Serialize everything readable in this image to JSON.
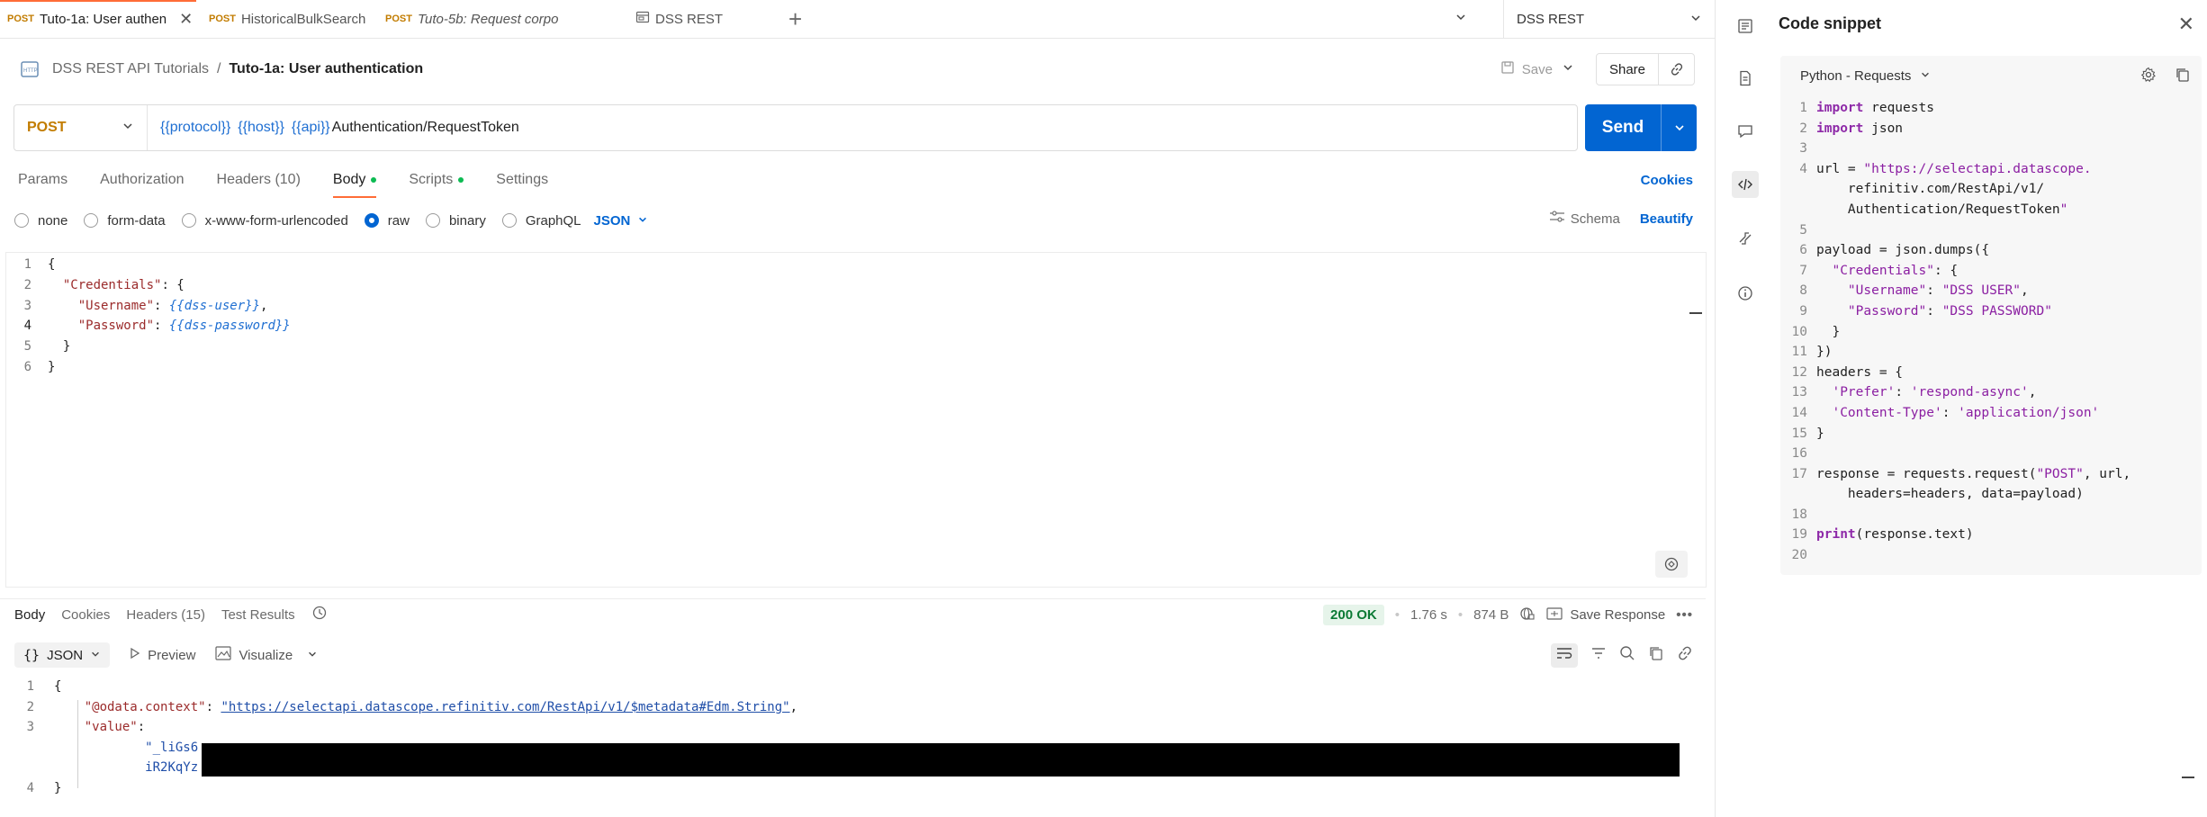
{
  "tabs": [
    {
      "method": "POST",
      "title": "Tuto-1a: User authen",
      "active": true
    },
    {
      "method": "POST",
      "title": "HistoricalBulkSearch",
      "active": false
    },
    {
      "method": "POST",
      "title": "Tuto-5b: Request corpo",
      "active": false
    },
    {
      "method": "",
      "title": "DSS REST",
      "active": false
    }
  ],
  "environment": "DSS REST",
  "breadcrumb": {
    "collection": "DSS REST API Tutorials",
    "request": "Tuto-1a: User authentication"
  },
  "toolbar": {
    "save_label": "Save",
    "share_label": "Share"
  },
  "request": {
    "method": "POST",
    "url_vars": [
      "{{protocol}}",
      "{{host}}",
      "{{api}}"
    ],
    "url_path": "Authentication/RequestToken",
    "send_label": "Send"
  },
  "request_tabs": {
    "params": "Params",
    "authorization": "Authorization",
    "headers": "Headers",
    "headers_count": "(10)",
    "body": "Body",
    "scripts": "Scripts",
    "settings": "Settings",
    "cookies": "Cookies"
  },
  "body_options": {
    "none": "none",
    "form_data": "form-data",
    "urlencoded": "x-www-form-urlencoded",
    "raw": "raw",
    "binary": "binary",
    "graphql": "GraphQL",
    "format": "JSON",
    "schema": "Schema",
    "beautify": "Beautify",
    "selected": "raw"
  },
  "body_code": {
    "l1": "{",
    "l2_key": "\"Credentials\"",
    "l2_rest": ": {",
    "l3_key": "\"Username\"",
    "l3_val": "{{dss-user}}",
    "l4_key": "\"Password\"",
    "l4_val": "{{dss-password}}",
    "l5": "}",
    "l6": "}"
  },
  "response_tabs": {
    "body": "Body",
    "cookies": "Cookies",
    "headers": "Headers (15)",
    "test_results": "Test Results"
  },
  "response_meta": {
    "status": "200 OK",
    "time": "1.76 s",
    "size": "874 B",
    "save_response": "Save Response"
  },
  "response_options": {
    "format": "JSON",
    "preview": "Preview",
    "visualize": "Visualize"
  },
  "response_code": {
    "l1": "{",
    "context_key": "\"@odata.context\"",
    "context_val": "\"https://selectapi.datascope.refinitiv.com/RestApi/v1/$metadata#Edm.String\"",
    "value_key": "\"value\"",
    "value_start": "\"_liGs6",
    "value_cont": "iR2KqYz",
    "l4": "}"
  },
  "snippet": {
    "title": "Code snippet",
    "language": "Python - Requests",
    "lines": [
      {
        "n": "1",
        "t": "import requests"
      },
      {
        "n": "2",
        "t": "import json"
      },
      {
        "n": "3",
        "t": ""
      },
      {
        "n": "4",
        "t": "url = \"https://selectapi.datascope."
      },
      {
        "n": "",
        "t": "    refinitiv.com/RestApi/v1/"
      },
      {
        "n": "",
        "t": "    Authentication/RequestToken\""
      },
      {
        "n": "5",
        "t": ""
      },
      {
        "n": "6",
        "t": "payload = json.dumps({"
      },
      {
        "n": "7",
        "t": "  \"Credentials\": {"
      },
      {
        "n": "8",
        "t": "    \"Username\": \"DSS USER\","
      },
      {
        "n": "9",
        "t": "    \"Password\": \"DSS PASSWORD\""
      },
      {
        "n": "10",
        "t": "  }"
      },
      {
        "n": "11",
        "t": "})"
      },
      {
        "n": "12",
        "t": "headers = {"
      },
      {
        "n": "13",
        "t": "  'Prefer': 'respond-async',"
      },
      {
        "n": "14",
        "t": "  'Content-Type': 'application/json'"
      },
      {
        "n": "15",
        "t": "}"
      },
      {
        "n": "16",
        "t": ""
      },
      {
        "n": "17",
        "t": "response = requests.request(\"POST\", url,"
      },
      {
        "n": "",
        "t": "    headers=headers, data=payload)"
      },
      {
        "n": "18",
        "t": ""
      },
      {
        "n": "19",
        "t": "print(response.text)"
      },
      {
        "n": "20",
        "t": ""
      }
    ]
  },
  "colors": {
    "accent": "#0265d2",
    "method": "#c27c00",
    "tab_indicator": "#ff6c37",
    "status_ok": "#0b7a35"
  }
}
